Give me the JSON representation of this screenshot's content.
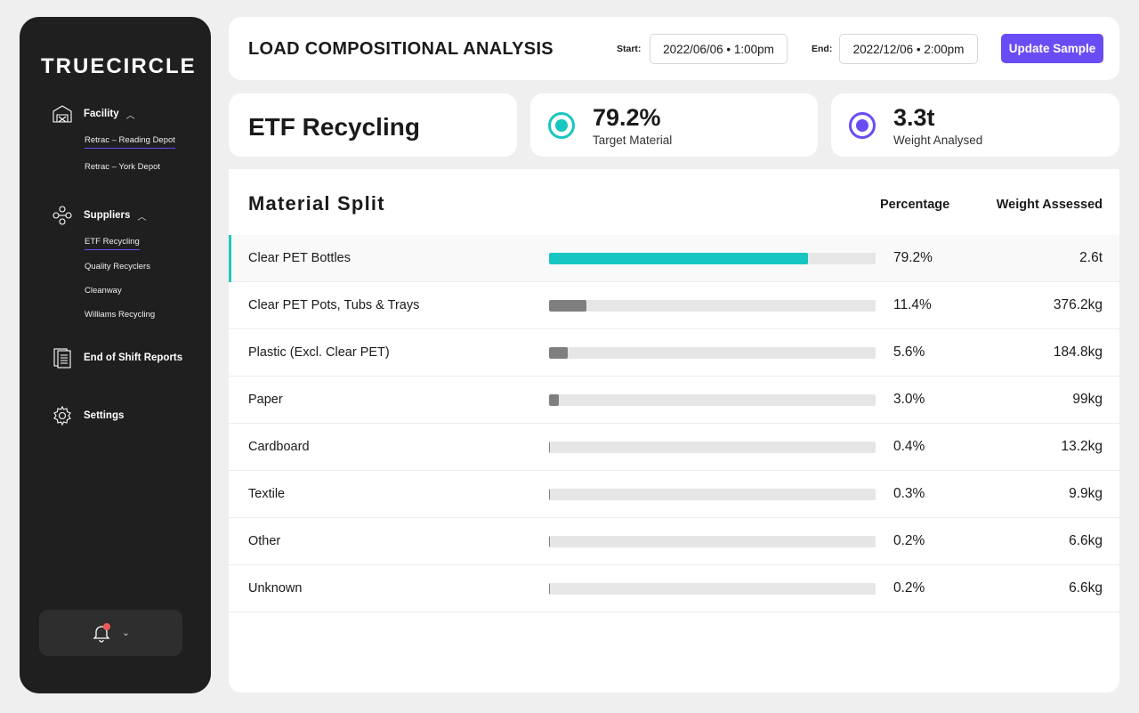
{
  "brand": "TRUECIRCLE",
  "sidebar": {
    "facility": {
      "label": "Facility",
      "items": [
        "Retrac – Reading Depot",
        "Retrac – York Depot"
      ]
    },
    "suppliers": {
      "label": "Suppliers",
      "items": [
        "ETF Recycling",
        "Quality Recyclers",
        "Cleanway",
        "Williams Recycling"
      ]
    },
    "reports_label": "End of Shift Reports",
    "settings_label": "Settings"
  },
  "header": {
    "title": "LOAD COMPOSITIONAL ANALYSIS",
    "start_label": "Start:",
    "start_value": "2022/06/06 • 1:00pm",
    "end_label": "End:",
    "end_value": "2022/12/06 • 2:00pm",
    "update_label": "Update Sample"
  },
  "stats": {
    "supplier": "ETF Recycling",
    "target_value": "79.2%",
    "target_label": "Target Material",
    "weight_value": "3.3t",
    "weight_label": "Weight Analysed"
  },
  "colors": {
    "accent": "#6a4cf5",
    "teal": "#17c6c0",
    "sidebar_bg": "#1f1f1f"
  },
  "table": {
    "title": "Material Split",
    "col_percentage": "Percentage",
    "col_weight": "Weight Assessed",
    "rows": [
      {
        "name": "Clear PET Bottles",
        "fill": 79.2,
        "pct": "79.2%",
        "weight": "2.6t"
      },
      {
        "name": "Clear PET Pots, Tubs & Trays",
        "fill": 11.4,
        "pct": "11.4%",
        "weight": "376.2kg"
      },
      {
        "name": "Plastic (Excl. Clear PET)",
        "fill": 5.6,
        "pct": "5.6%",
        "weight": "184.8kg"
      },
      {
        "name": "Paper",
        "fill": 3.0,
        "pct": "3.0%",
        "weight": "99kg"
      },
      {
        "name": "Cardboard",
        "fill": 0.4,
        "pct": "0.4%",
        "weight": "13.2kg"
      },
      {
        "name": "Textile",
        "fill": 0.3,
        "pct": "0.3%",
        "weight": "9.9kg"
      },
      {
        "name": "Other",
        "fill": 0.2,
        "pct": "0.2%",
        "weight": "6.6kg"
      },
      {
        "name": "Unknown",
        "fill": 0.2,
        "pct": "0.2%",
        "weight": "6.6kg"
      }
    ]
  }
}
